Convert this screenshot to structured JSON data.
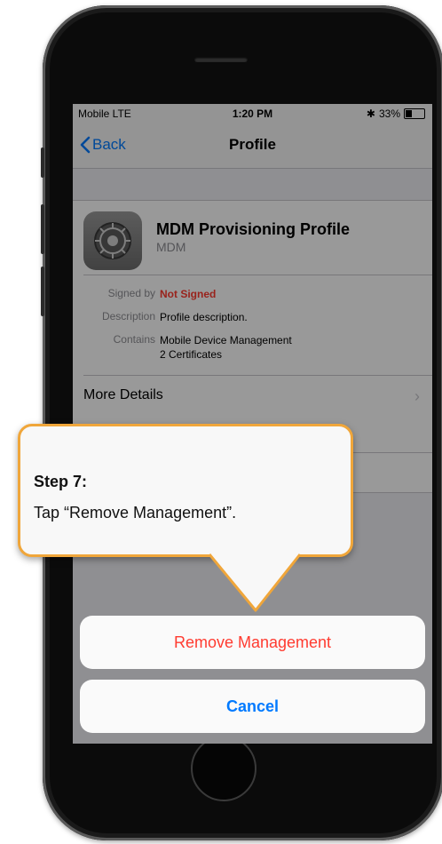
{
  "status_bar": {
    "carrier": "Mobile  LTE",
    "time": "1:20 PM",
    "battery": "33%",
    "battery_level": 0.33
  },
  "nav": {
    "back_label": "Back",
    "title": "Profile"
  },
  "profile": {
    "name": "MDM Provisioning Profile",
    "subtitle": "MDM",
    "details": [
      {
        "label": "Signed by",
        "value": "Not Signed"
      },
      {
        "label": "Description",
        "value": "Profile description."
      },
      {
        "label": "Contains",
        "value": "Mobile Device Management",
        "value2": "2 Certificates"
      }
    ],
    "more_details": "More Details"
  },
  "action_sheet": {
    "remove_label": "Remove Management",
    "cancel_label": "Cancel"
  },
  "callout": {
    "title": "Step 7:",
    "text": "Tap “Remove Management”."
  },
  "colors": {
    "accent": "#007aff",
    "destructive": "#ff3b30",
    "callout_border": "#f0a63a"
  }
}
